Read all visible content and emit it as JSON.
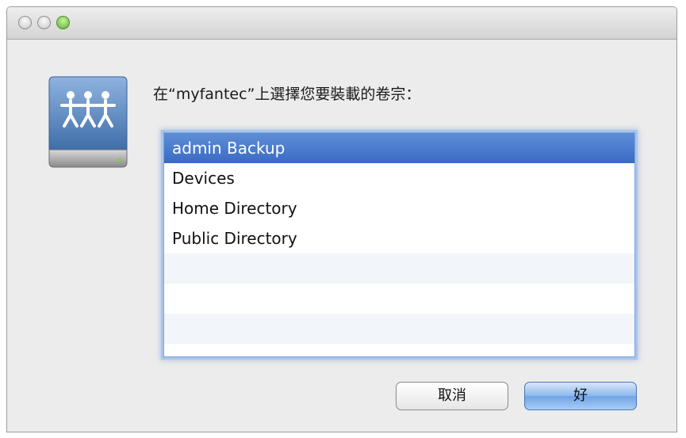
{
  "window": {
    "traffic_lights": [
      "close",
      "minimize",
      "zoom"
    ]
  },
  "icon": "network-drive-icon",
  "prompt": "在“myfantec”上選擇您要裝載的卷宗：",
  "volumes": [
    {
      "label": "admin Backup",
      "selected": true
    },
    {
      "label": "Devices",
      "selected": false
    },
    {
      "label": "Home Directory",
      "selected": false
    },
    {
      "label": "Public Directory",
      "selected": false
    }
  ],
  "buttons": {
    "cancel": "取消",
    "ok": "好"
  },
  "colors": {
    "selection": "#3a6bc4",
    "default_button": "#6fa3e6"
  }
}
